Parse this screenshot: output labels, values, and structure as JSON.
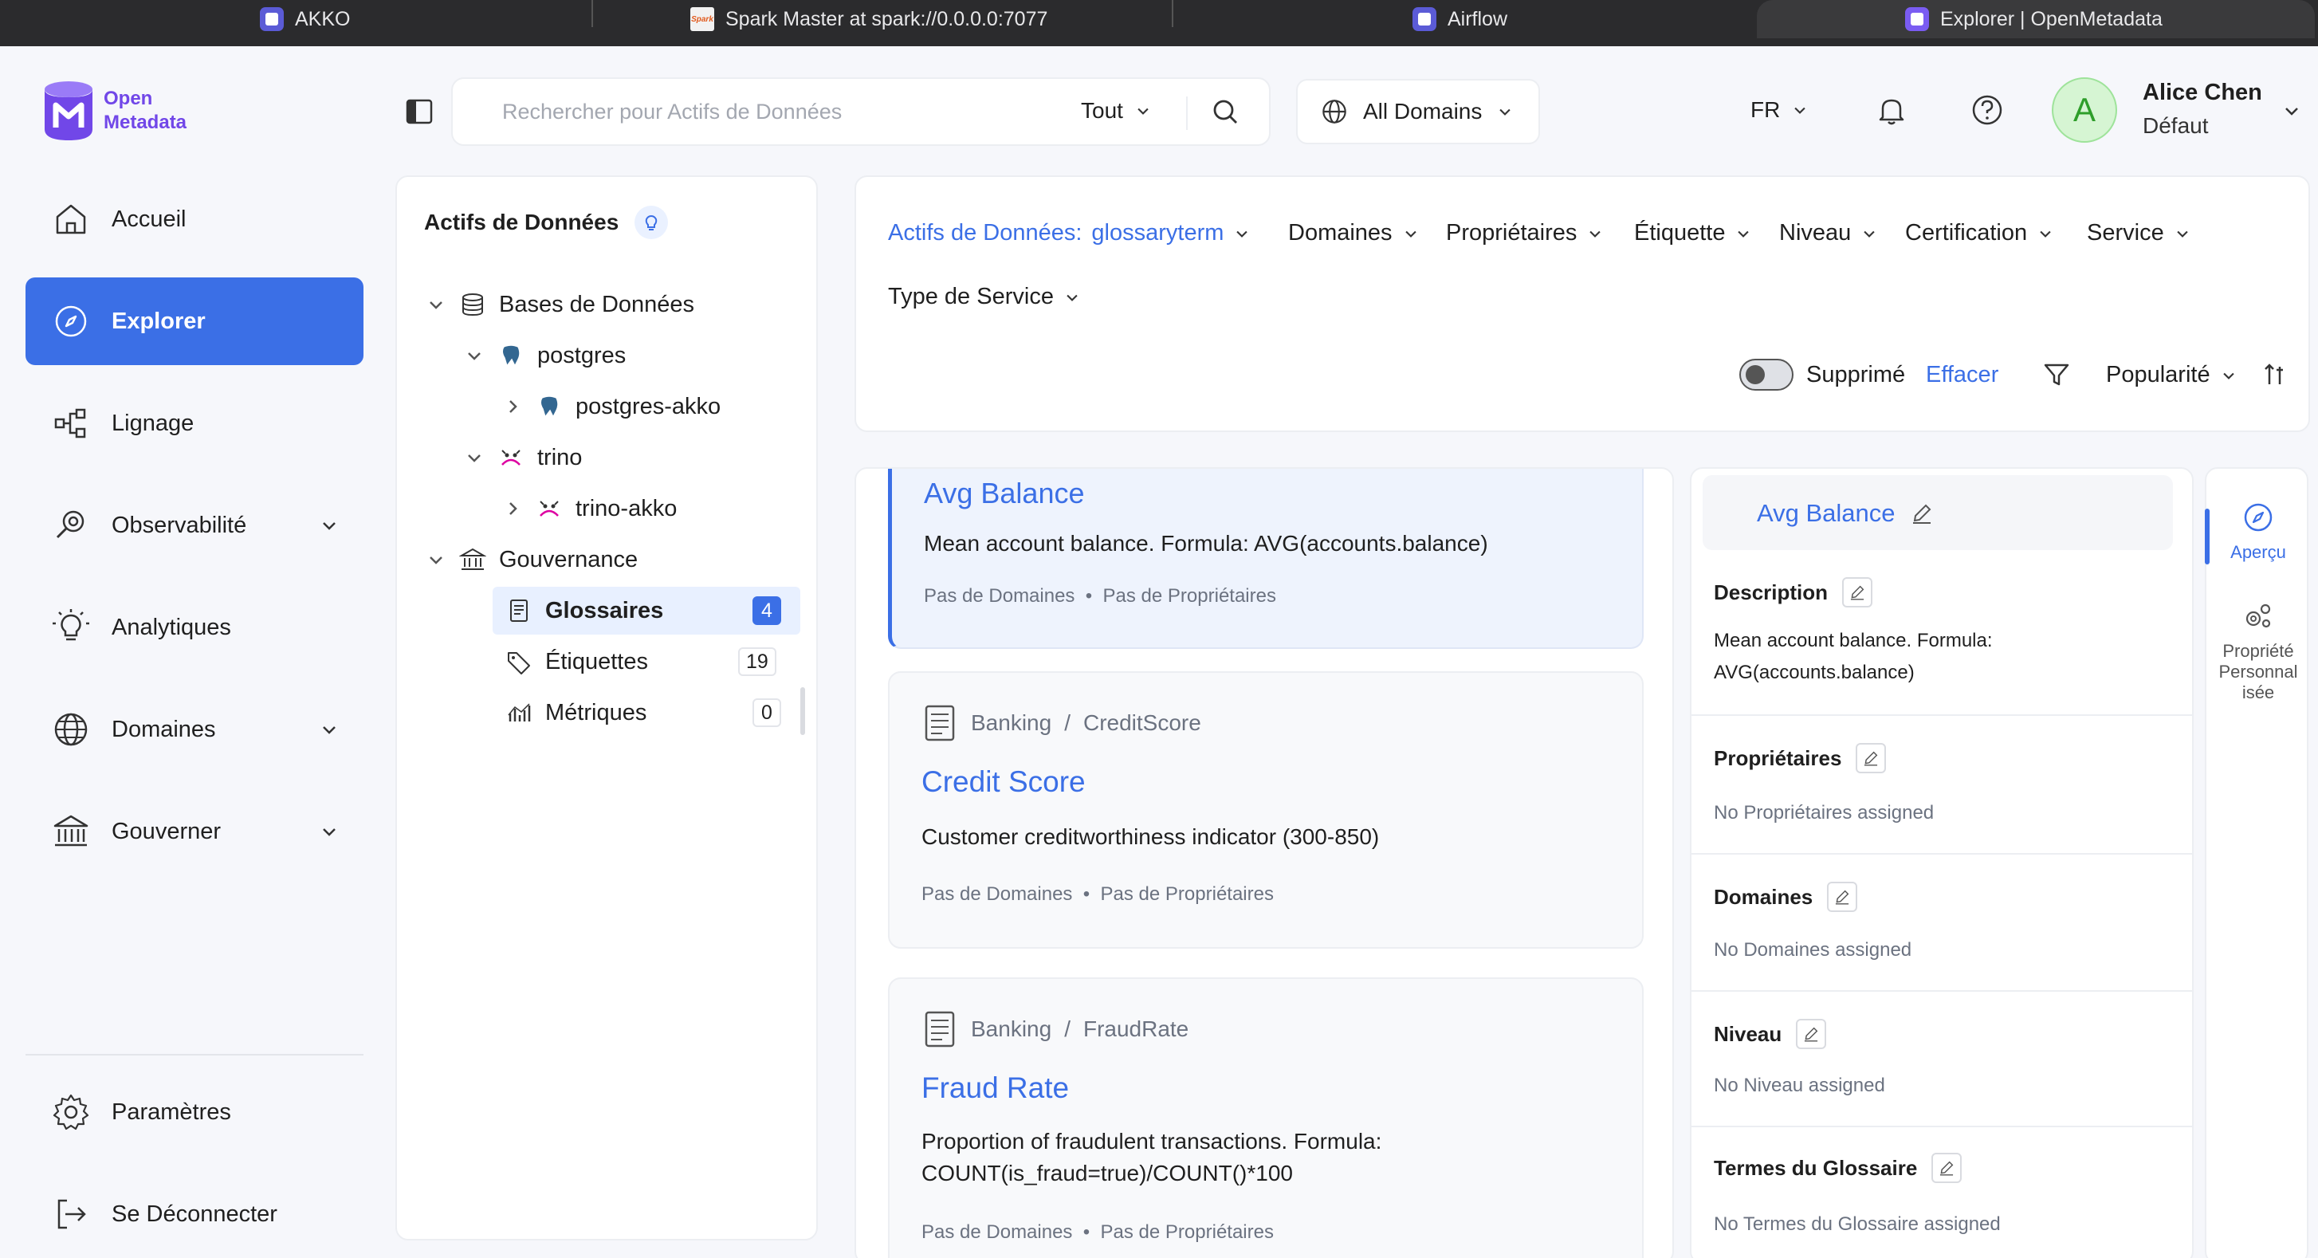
{
  "browser_tabs": [
    {
      "title": "AKKO"
    },
    {
      "title": "Spark Master at spark://0.0.0.0:7077",
      "favicon_text": "Spark"
    },
    {
      "title": "Airflow"
    },
    {
      "title": "Explorer | OpenMetadata"
    }
  ],
  "brand": {
    "line1": "Open",
    "line2": "Metadata",
    "color": "#7147e8"
  },
  "nav": {
    "items": [
      {
        "label": "Accueil",
        "icon": "home-icon"
      },
      {
        "label": "Explorer",
        "icon": "compass-icon",
        "active": true
      },
      {
        "label": "Lignage",
        "icon": "lineage-icon"
      },
      {
        "label": "Observabilité",
        "icon": "observability-icon",
        "has_children": true
      },
      {
        "label": "Analytiques",
        "icon": "bulb-icon"
      },
      {
        "label": "Domaines",
        "icon": "globe-icon",
        "has_children": true
      },
      {
        "label": "Gouverner",
        "icon": "bank-icon",
        "has_children": true
      }
    ],
    "settings_label": "Paramètres",
    "logout_label": "Se Déconnecter"
  },
  "header": {
    "search_placeholder": "Rechercher pour Actifs de Données",
    "search_scope": "Tout",
    "domains_label": "All Domains",
    "language": "FR",
    "user_initial": "A",
    "user_name": "Alice Chen",
    "user_role": "Défaut"
  },
  "tree": {
    "title": "Actifs de Données",
    "databases_label": "Bases de Données",
    "postgres_label": "postgres",
    "postgres_child_label": "postgres-akko",
    "trino_label": "trino",
    "trino_child_label": "trino-akko",
    "governance_label": "Gouvernance",
    "glossaries_label": "Glossaires",
    "glossaries_count": "4",
    "tags_label": "Étiquettes",
    "tags_count": "19",
    "metrics_label": "Métriques",
    "metrics_count": "0"
  },
  "filters": {
    "asset_prefix": "Actifs de Données:",
    "asset_value": "glossaryterm",
    "domains": "Domaines",
    "owners": "Propriétaires",
    "tag": "Étiquette",
    "tier": "Niveau",
    "certification": "Certification",
    "service": "Service",
    "service_type": "Type de Service",
    "deleted_label": "Supprimé",
    "clear_label": "Effacer",
    "sort_label": "Popularité"
  },
  "results": [
    {
      "title": "Avg Balance",
      "description": "Mean account balance. Formula: AVG(accounts.balance)",
      "domains": "Pas de Domaines",
      "owners": "Pas de Propriétaires"
    },
    {
      "crumb_parent": "Banking",
      "crumb_sep": "/",
      "crumb_child": "CreditScore",
      "title": "Credit Score",
      "description": "Customer creditworthiness indicator (300-850)",
      "domains": "Pas de Domaines",
      "owners": "Pas de Propriétaires"
    },
    {
      "crumb_parent": "Banking",
      "crumb_sep": "/",
      "crumb_child": "FraudRate",
      "title": "Fraud Rate",
      "description_line1": "Proportion of fraudulent transactions. Formula:",
      "description_line2": "COUNT(is_fraud=true)/COUNT()*100",
      "domains": "Pas de Domaines",
      "owners": "Pas de Propriétaires"
    }
  ],
  "detail": {
    "title": "Avg Balance",
    "description_label": "Description",
    "description_line1": "Mean account balance. Formula:",
    "description_line2": "AVG(accounts.balance)",
    "owners_label": "Propriétaires",
    "owners_value": "No Propriétaires assigned",
    "domains_label": "Domaines",
    "domains_value": "No Domaines assigned",
    "tier_label": "Niveau",
    "tier_value": "No Niveau assigned",
    "glossary_label": "Termes du Glossaire",
    "glossary_value": "No Termes du Glossaire assigned"
  },
  "rail": {
    "overview_label": "Aperçu",
    "custom_props_line1": "Propriété",
    "custom_props_line2": "Personnal",
    "custom_props_line3": "isée"
  },
  "colors": {
    "accent": "#3b6fe6",
    "brand": "#7147e8",
    "avatar_bg": "#d6f5d3"
  }
}
